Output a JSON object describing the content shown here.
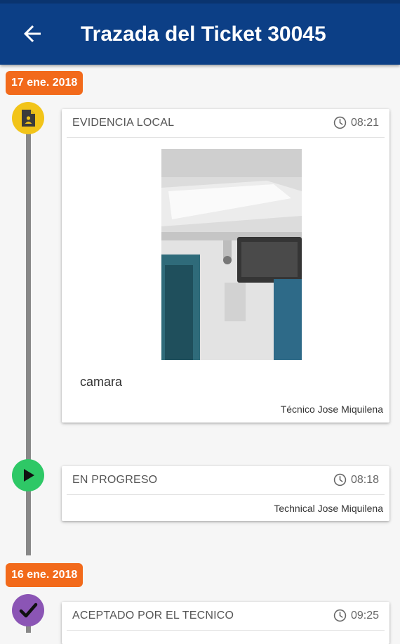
{
  "header": {
    "title": "Trazada del Ticket 30045",
    "back_icon": "arrow-back-icon",
    "background": "#0c3f86"
  },
  "colors": {
    "date_badge": "#f26a1b",
    "node_evidence": "#f2c419",
    "node_progress": "#2ec866",
    "node_accepted": "#8b55b5",
    "timeline": "#888888"
  },
  "timeline": {
    "groups": [
      {
        "date": "17 ene. 2018",
        "events": [
          {
            "status": "EVIDENCIA LOCAL",
            "time": "08:21",
            "icon": "document-icon",
            "photo": "ceiling-camera-photo",
            "caption": "camara",
            "author": "Técnico Jose Miquilena"
          },
          {
            "status": "EN PROGRESO",
            "time": "08:18",
            "icon": "play-icon",
            "author": "Technical Jose Miquilena"
          }
        ]
      },
      {
        "date": "16 ene. 2018",
        "events": [
          {
            "status": "ACEPTADO POR EL TECNICO",
            "time": "09:25",
            "icon": "checkmark-icon"
          }
        ]
      }
    ]
  }
}
